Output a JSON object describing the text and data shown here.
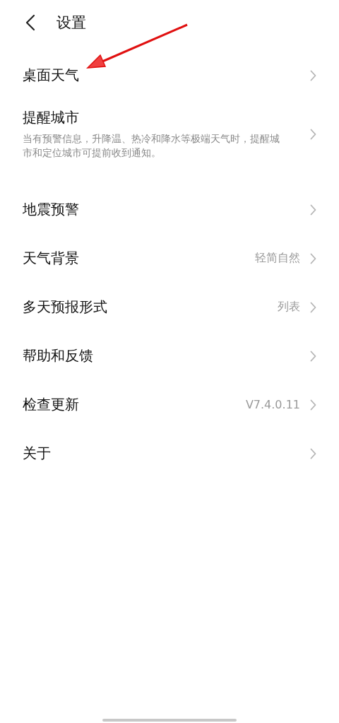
{
  "header": {
    "title": "设置"
  },
  "sections": [
    {
      "items": [
        {
          "title": "桌面天气"
        },
        {
          "title": "提醒城市",
          "description": "当有预警信息，升降温、热冷和降水等极端天气时，提醒城市和定位城市可提前收到通知。"
        }
      ]
    },
    {
      "items": [
        {
          "title": "地震预警"
        },
        {
          "title": "天气背景",
          "value": "轻简自然"
        },
        {
          "title": "多天预报形式",
          "value": "列表"
        },
        {
          "title": "帮助和反馈"
        },
        {
          "title": "检查更新",
          "value": "V7.4.0.11"
        },
        {
          "title": "关于"
        }
      ]
    }
  ]
}
